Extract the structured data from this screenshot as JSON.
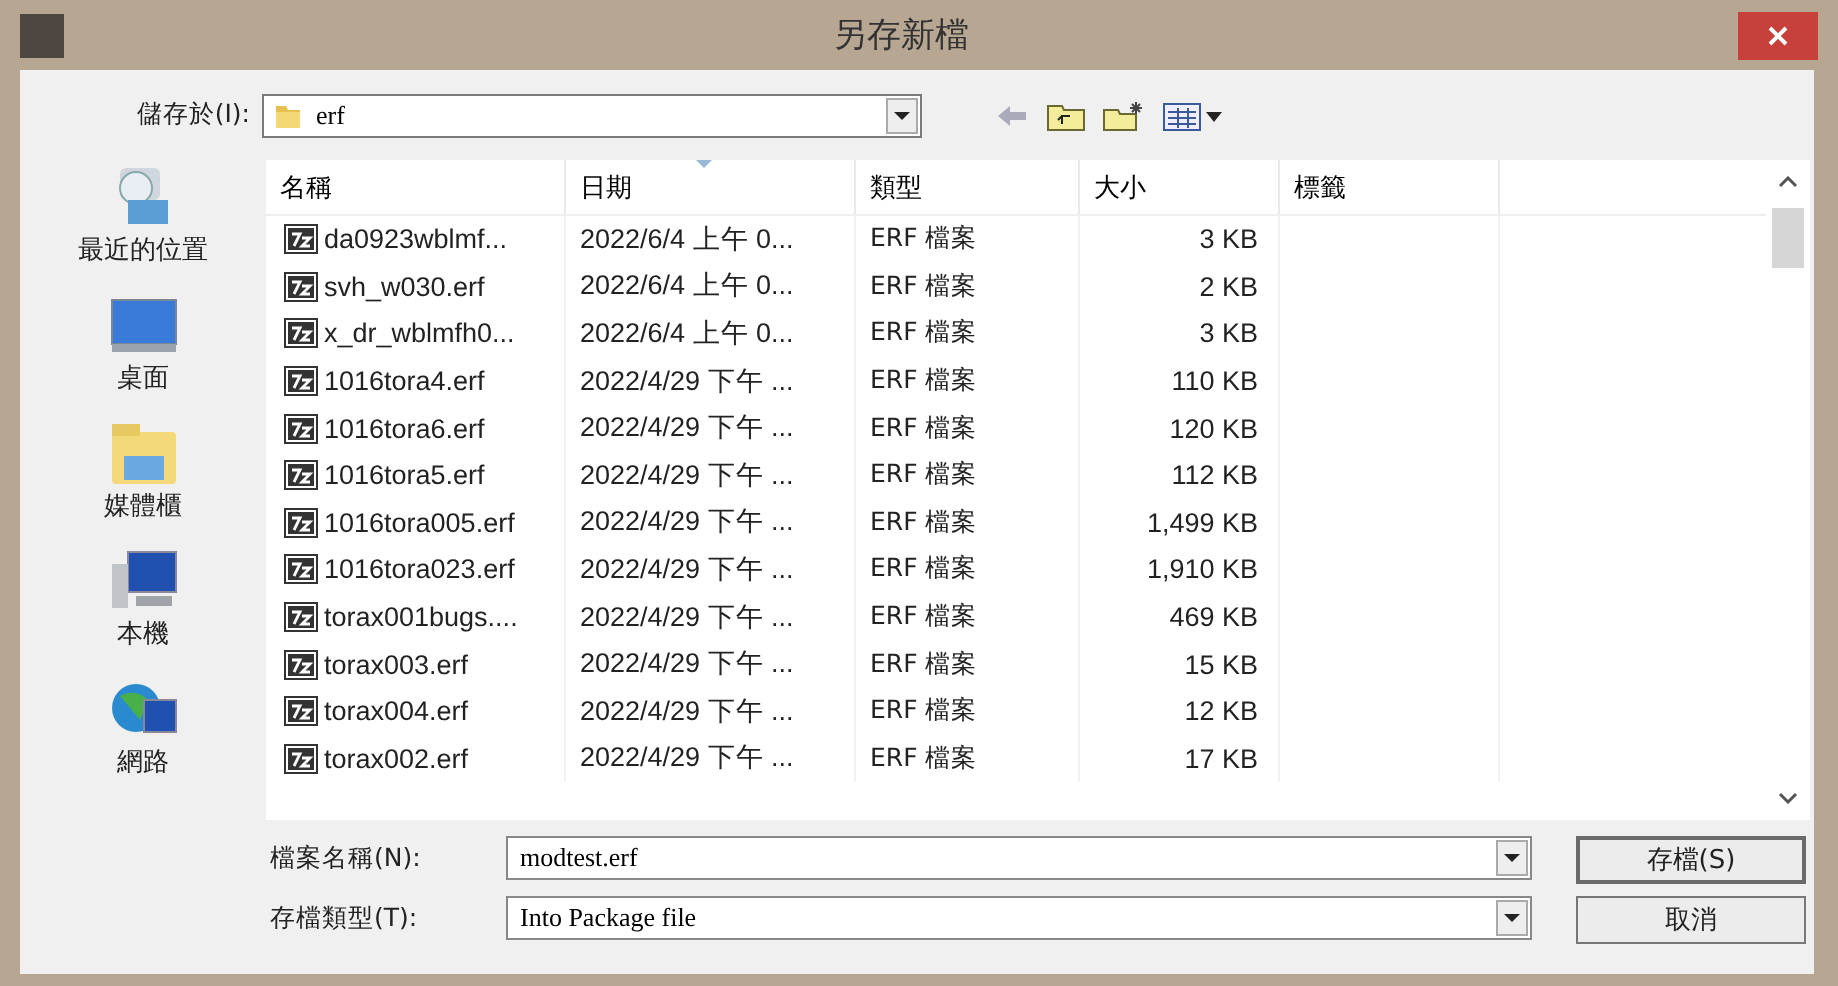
{
  "window": {
    "title": "另存新檔"
  },
  "save_in": {
    "label": "儲存於(I):",
    "value": "erf"
  },
  "places": [
    {
      "label": "最近的位置",
      "kind": "recent"
    },
    {
      "label": "桌面",
      "kind": "desktop"
    },
    {
      "label": "媒體櫃",
      "kind": "library"
    },
    {
      "label": "本機",
      "kind": "computer"
    },
    {
      "label": "網路",
      "kind": "network"
    }
  ],
  "file_list": {
    "columns": [
      {
        "label": "名稱",
        "sorted": false
      },
      {
        "label": "日期",
        "sorted": true
      },
      {
        "label": "類型",
        "sorted": false
      },
      {
        "label": "大小",
        "sorted": false
      },
      {
        "label": "標籤",
        "sorted": false
      }
    ],
    "rows": [
      {
        "name": "da0923wblmf...",
        "date": "2022/6/4 上午 0...",
        "type": "ERF 檔案",
        "size": "3 KB"
      },
      {
        "name": "svh_w030.erf",
        "date": "2022/6/4 上午 0...",
        "type": "ERF 檔案",
        "size": "2 KB"
      },
      {
        "name": "x_dr_wblmfh0...",
        "date": "2022/6/4 上午 0...",
        "type": "ERF 檔案",
        "size": "3 KB"
      },
      {
        "name": "1016tora4.erf",
        "date": "2022/4/29 下午 ...",
        "type": "ERF 檔案",
        "size": "110 KB"
      },
      {
        "name": "1016tora6.erf",
        "date": "2022/4/29 下午 ...",
        "type": "ERF 檔案",
        "size": "120 KB"
      },
      {
        "name": "1016tora5.erf",
        "date": "2022/4/29 下午 ...",
        "type": "ERF 檔案",
        "size": "112 KB"
      },
      {
        "name": "1016tora005.erf",
        "date": "2022/4/29 下午 ...",
        "type": "ERF 檔案",
        "size": "1,499 KB"
      },
      {
        "name": "1016tora023.erf",
        "date": "2022/4/29 下午 ...",
        "type": "ERF 檔案",
        "size": "1,910 KB"
      },
      {
        "name": "torax001bugs....",
        "date": "2022/4/29 下午 ...",
        "type": "ERF 檔案",
        "size": "469 KB"
      },
      {
        "name": "torax003.erf",
        "date": "2022/4/29 下午 ...",
        "type": "ERF 檔案",
        "size": "15 KB"
      },
      {
        "name": "torax004.erf",
        "date": "2022/4/29 下午 ...",
        "type": "ERF 檔案",
        "size": "12 KB"
      },
      {
        "name": "torax002.erf",
        "date": "2022/4/29 下午 ...",
        "type": "ERF 檔案",
        "size": "17 KB"
      }
    ]
  },
  "filename": {
    "label": "檔案名稱(N):",
    "value": "modtest.erf"
  },
  "filetype": {
    "label": "存檔類型(T):",
    "value": "Into Package file"
  },
  "buttons": [
    {
      "label": "存檔(S)",
      "kind": "default"
    },
    {
      "label": "取消",
      "kind": "normal"
    }
  ]
}
